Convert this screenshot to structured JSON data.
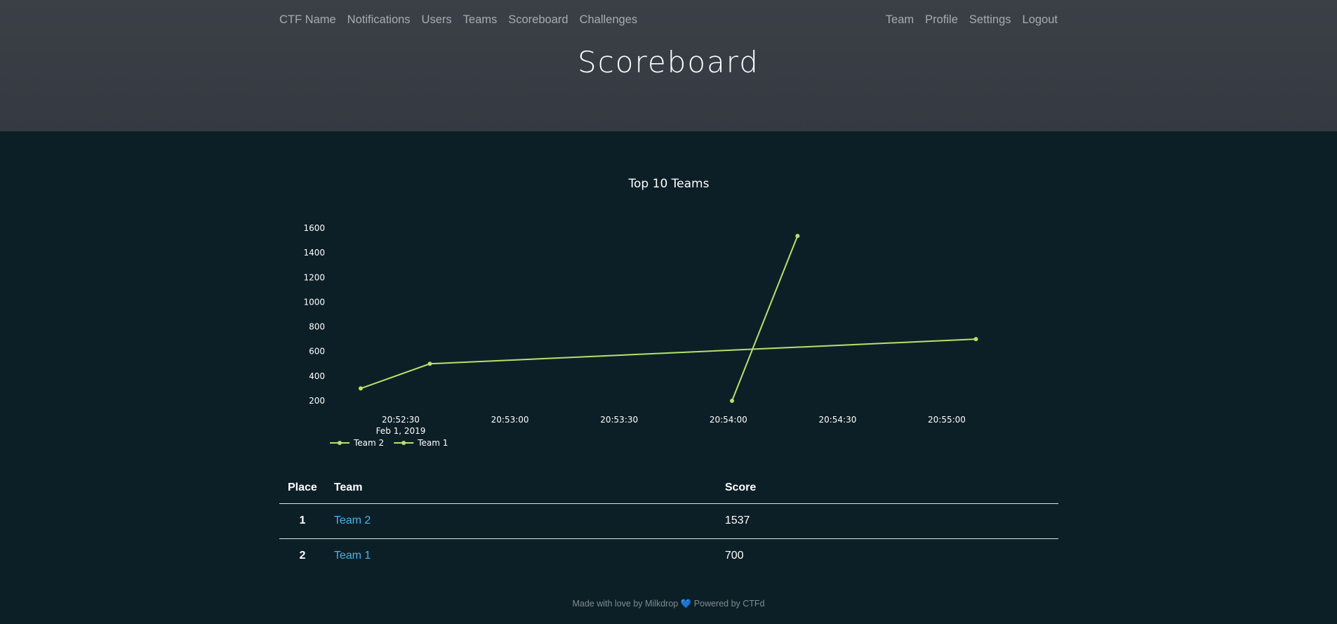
{
  "nav": {
    "brand": "CTF Name",
    "left_items": [
      "Notifications",
      "Users",
      "Teams",
      "Scoreboard",
      "Challenges"
    ],
    "right_items": [
      "Team",
      "Profile",
      "Settings",
      "Logout"
    ]
  },
  "page_title": "Scoreboard",
  "chart_data": {
    "type": "line",
    "title": "Top 10 Teams",
    "xlabel": "",
    "ylabel": "",
    "x_ticks": [
      "20:52:30",
      "20:53:00",
      "20:53:30",
      "20:54:00",
      "20:54:30",
      "20:55:00"
    ],
    "x_date_label": "Feb 1, 2019",
    "y_ticks": [
      200,
      400,
      600,
      800,
      1000,
      1200,
      1400,
      1600
    ],
    "ylim": [
      200,
      1600
    ],
    "legend_position": "bottom-left",
    "color": "#b5e36b",
    "series": [
      {
        "name": "Team 2",
        "x": [
          "20:54:01",
          "20:54:19"
        ],
        "values": [
          200,
          1537
        ]
      },
      {
        "name": "Team 1",
        "x": [
          "20:52:19",
          "20:52:38",
          "20:55:08"
        ],
        "values": [
          300,
          500,
          700
        ]
      }
    ]
  },
  "table": {
    "headers": {
      "place": "Place",
      "team": "Team",
      "score": "Score"
    },
    "rows": [
      {
        "place": "1",
        "team": "Team 2",
        "score": "1537"
      },
      {
        "place": "2",
        "team": "Team 1",
        "score": "700"
      }
    ]
  },
  "footer": {
    "text": "Made with love by Milkdrop",
    "heart": "💙",
    "powered": "Powered by CTFd"
  }
}
